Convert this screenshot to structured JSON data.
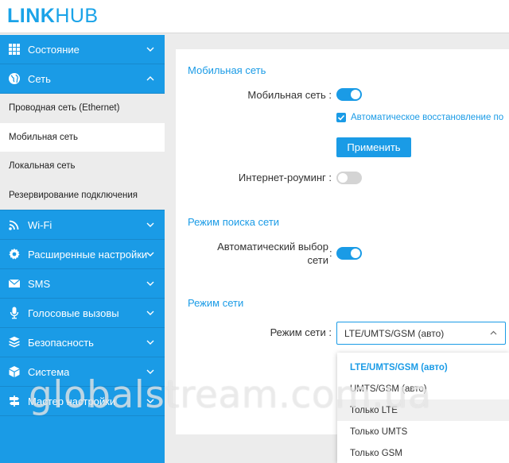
{
  "brand": {
    "logo_bold": "LINK",
    "logo_light": "HUB",
    "color": "#1aa3e8"
  },
  "colors": {
    "accent": "#1a9be6",
    "sidebar_bg": "#1a9be6",
    "toggle_off": "#d4d4d4"
  },
  "sidebar": {
    "items_top": [
      {
        "label": "Состояние",
        "icon": "grid-icon",
        "expanded": false
      },
      {
        "label": "Сеть",
        "icon": "globe-icon",
        "expanded": true
      }
    ],
    "network_submenu": [
      {
        "label": "Проводная сеть (Ethernet)",
        "active": false
      },
      {
        "label": "Мобильная сеть",
        "active": true
      },
      {
        "label": "Локальная сеть",
        "active": false
      },
      {
        "label": "Резервирование подключения",
        "active": false
      }
    ],
    "items_bottom": [
      {
        "label": "Wi-Fi",
        "icon": "wifi-icon"
      },
      {
        "label": "Расширенные настройки",
        "icon": "gear-icon"
      },
      {
        "label": "SMS",
        "icon": "envelope-icon"
      },
      {
        "label": "Голосовые вызовы",
        "icon": "microphone-icon"
      },
      {
        "label": "Безопасность",
        "icon": "shield-icon"
      },
      {
        "label": "Система",
        "icon": "cube-icon"
      },
      {
        "label": "Мастер настройки",
        "icon": "signpost-icon"
      }
    ]
  },
  "mobile_network": {
    "title": "Мобильная сеть",
    "mobile_label": "Мобильная сеть :",
    "mobile_on": true,
    "auto_restore_label": "Автоматическое восстановление по",
    "auto_restore_checked": true,
    "apply_label": "Применить",
    "roaming_label": "Интернет-роуминг :",
    "roaming_on": false
  },
  "network_search": {
    "title": "Режим поиска сети",
    "auto_select_label_line1": "Автоматический выбор",
    "auto_select_label_line2": "сети",
    "colon": ":",
    "auto_select_on": true
  },
  "network_mode": {
    "title": "Режим сети",
    "mode_label": "Режим сети :",
    "selected": "LTE/UMTS/GSM (авто)",
    "options": [
      "LTE/UMTS/GSM (авто)",
      "UMTS/GSM (авто)",
      "Только LTE",
      "Только UMTS",
      "Только GSM"
    ]
  },
  "watermark": "globalstream.com.ua"
}
